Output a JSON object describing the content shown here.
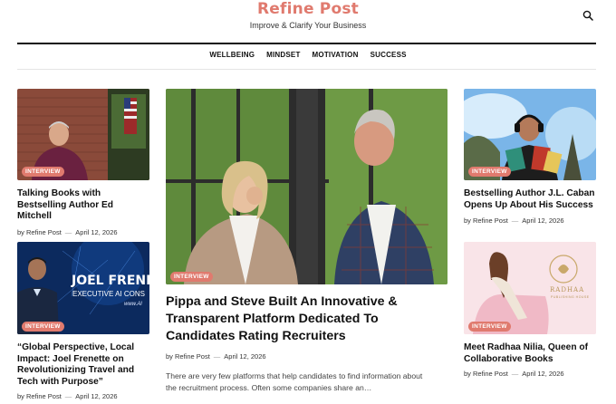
{
  "site": {
    "title": "Refine Post",
    "tagline": "Improve & Clarify Your Business"
  },
  "nav": [
    "WELLBEING",
    "MINDSET",
    "MOTIVATION",
    "SUCCESS"
  ],
  "badge_label": "INTERVIEW",
  "posts": {
    "left_top": {
      "title": "Talking Books with Bestselling Author Ed Mitchell",
      "author": "by Refine Post",
      "date": "April 12, 2026"
    },
    "left_bottom": {
      "title": "“Global Perspective, Local Impact: Joel Frenette on Revolutionizing Travel and Tech with Purpose”",
      "author": "by Refine Post",
      "date": "April 12, 2026",
      "image_text": {
        "name": "JOEL FRENE",
        "subtitle": "EXECUTIVE AI CONS",
        "url": "www.Al"
      }
    },
    "featured": {
      "title": "Pippa and Steve Built An Innovative & Transparent Platform Dedicated To Candidates Rating Recruiters",
      "author": "by Refine Post",
      "date": "April 12, 2026",
      "excerpt": "There are very few platforms that help candidates to find information about the recruitment process. Often some companies share an…"
    },
    "right_top": {
      "title": "Bestselling Author J.L. Caban Opens Up About His Success",
      "author": "by Refine Post",
      "date": "April 12, 2026"
    },
    "right_bottom": {
      "title": "Meet Radhaa Nilia, Queen of Collaborative Books",
      "author": "by Refine Post",
      "date": "April 12, 2026",
      "image_text": {
        "brand": "RADHAA",
        "sub": "PUBLISHING HOUSE"
      }
    }
  },
  "colors": {
    "accent": "#e07a6e",
    "text": "#111111"
  }
}
